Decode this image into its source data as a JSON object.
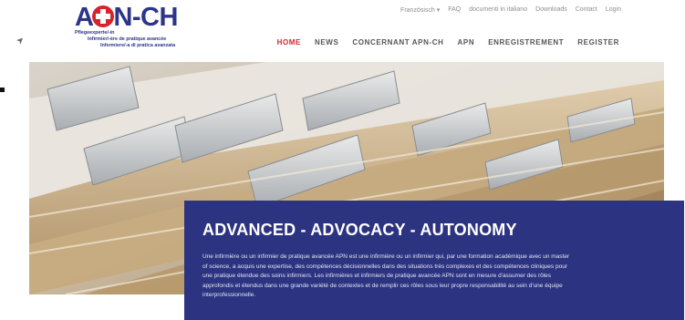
{
  "logo": {
    "text": "APN-CH",
    "line1": "Pflegeexperte/-in",
    "line2": "Infirmier/-ère de pratique avancée",
    "line3": "Infermiere/-a di pratica avanzata"
  },
  "topnav": {
    "language": "Französisch",
    "faq": "FAQ",
    "italian": "documenti in italiano",
    "downloads": "Downloads",
    "contact": "Contact",
    "login": "Login"
  },
  "mainnav": {
    "home": "HOME",
    "news": "NEWS",
    "concernant": "CONCERNANT APN-CH",
    "apn": "APN",
    "enregistrement": "ENREGISTREMENT",
    "register": "REGISTER"
  },
  "hero": {
    "title": "ADVANCED - ADVOCACY - AUTONOMY",
    "text": "Une infirmière ou un infirmier de pratique avancée APN est une infirmière ou un infirmier qui, par une formation académique avec un master of science, a acquis une expertise, des compétences décisionnelles dans des situations très complexes et des compétences cliniques pour une pratique étendue des soins infirmiers. Les infirmières et infirmiers de pratique avancée APN sont en mesure d'assumer des rôles approfondis et étendus dans une grande variété de contextes et de remplir ces rôles sous leur propre responsabilité au sein d'une équipe interprofessionnelle."
  },
  "icons": {
    "topnav_dropdown": "caret-down-icon",
    "cursor": "mouse-cursor-icon"
  },
  "colors": {
    "brand_blue": "#2c3588",
    "brand_red": "#d6232c",
    "overlay_blue": "#2c3380",
    "nav_active": "#d6232c"
  }
}
